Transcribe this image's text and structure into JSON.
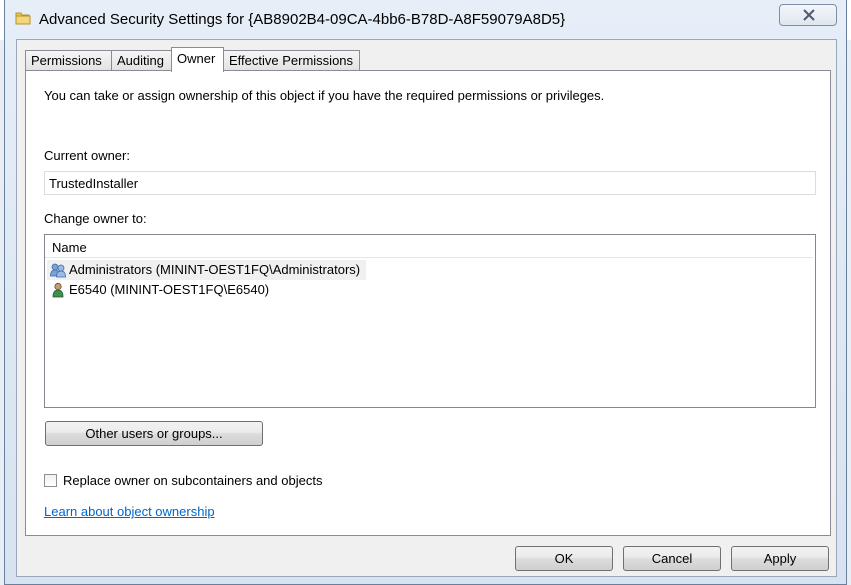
{
  "window": {
    "title": "Advanced Security Settings for {AB8902B4-09CA-4bb6-B78D-A8F59079A8D5}"
  },
  "tabs": [
    {
      "label": "Permissions"
    },
    {
      "label": "Auditing"
    },
    {
      "label": "Owner",
      "active": true
    },
    {
      "label": "Effective Permissions"
    }
  ],
  "owner_tab": {
    "intro": "You can take or assign ownership of this object if you have the required permissions or privileges.",
    "current_owner_label": "Current owner:",
    "current_owner_value": "TrustedInstaller",
    "change_owner_label": "Change owner to:",
    "list": {
      "column_header": "Name",
      "rows": [
        {
          "icon": "group-icon",
          "label": "Administrators (MININT-OEST1FQ\\Administrators)",
          "selected": true
        },
        {
          "icon": "user-icon",
          "label": "E6540 (MININT-OEST1FQ\\E6540)",
          "selected": false
        }
      ]
    },
    "other_users_button": "Other users or groups...",
    "replace_checkbox_label": "Replace owner on subcontainers and objects",
    "replace_checked": false,
    "learn_link": "Learn about object ownership"
  },
  "buttons": {
    "ok": "OK",
    "cancel": "Cancel",
    "apply": "Apply"
  },
  "colors": {
    "link": "#0066cc",
    "frame": "#dfe9f5"
  }
}
